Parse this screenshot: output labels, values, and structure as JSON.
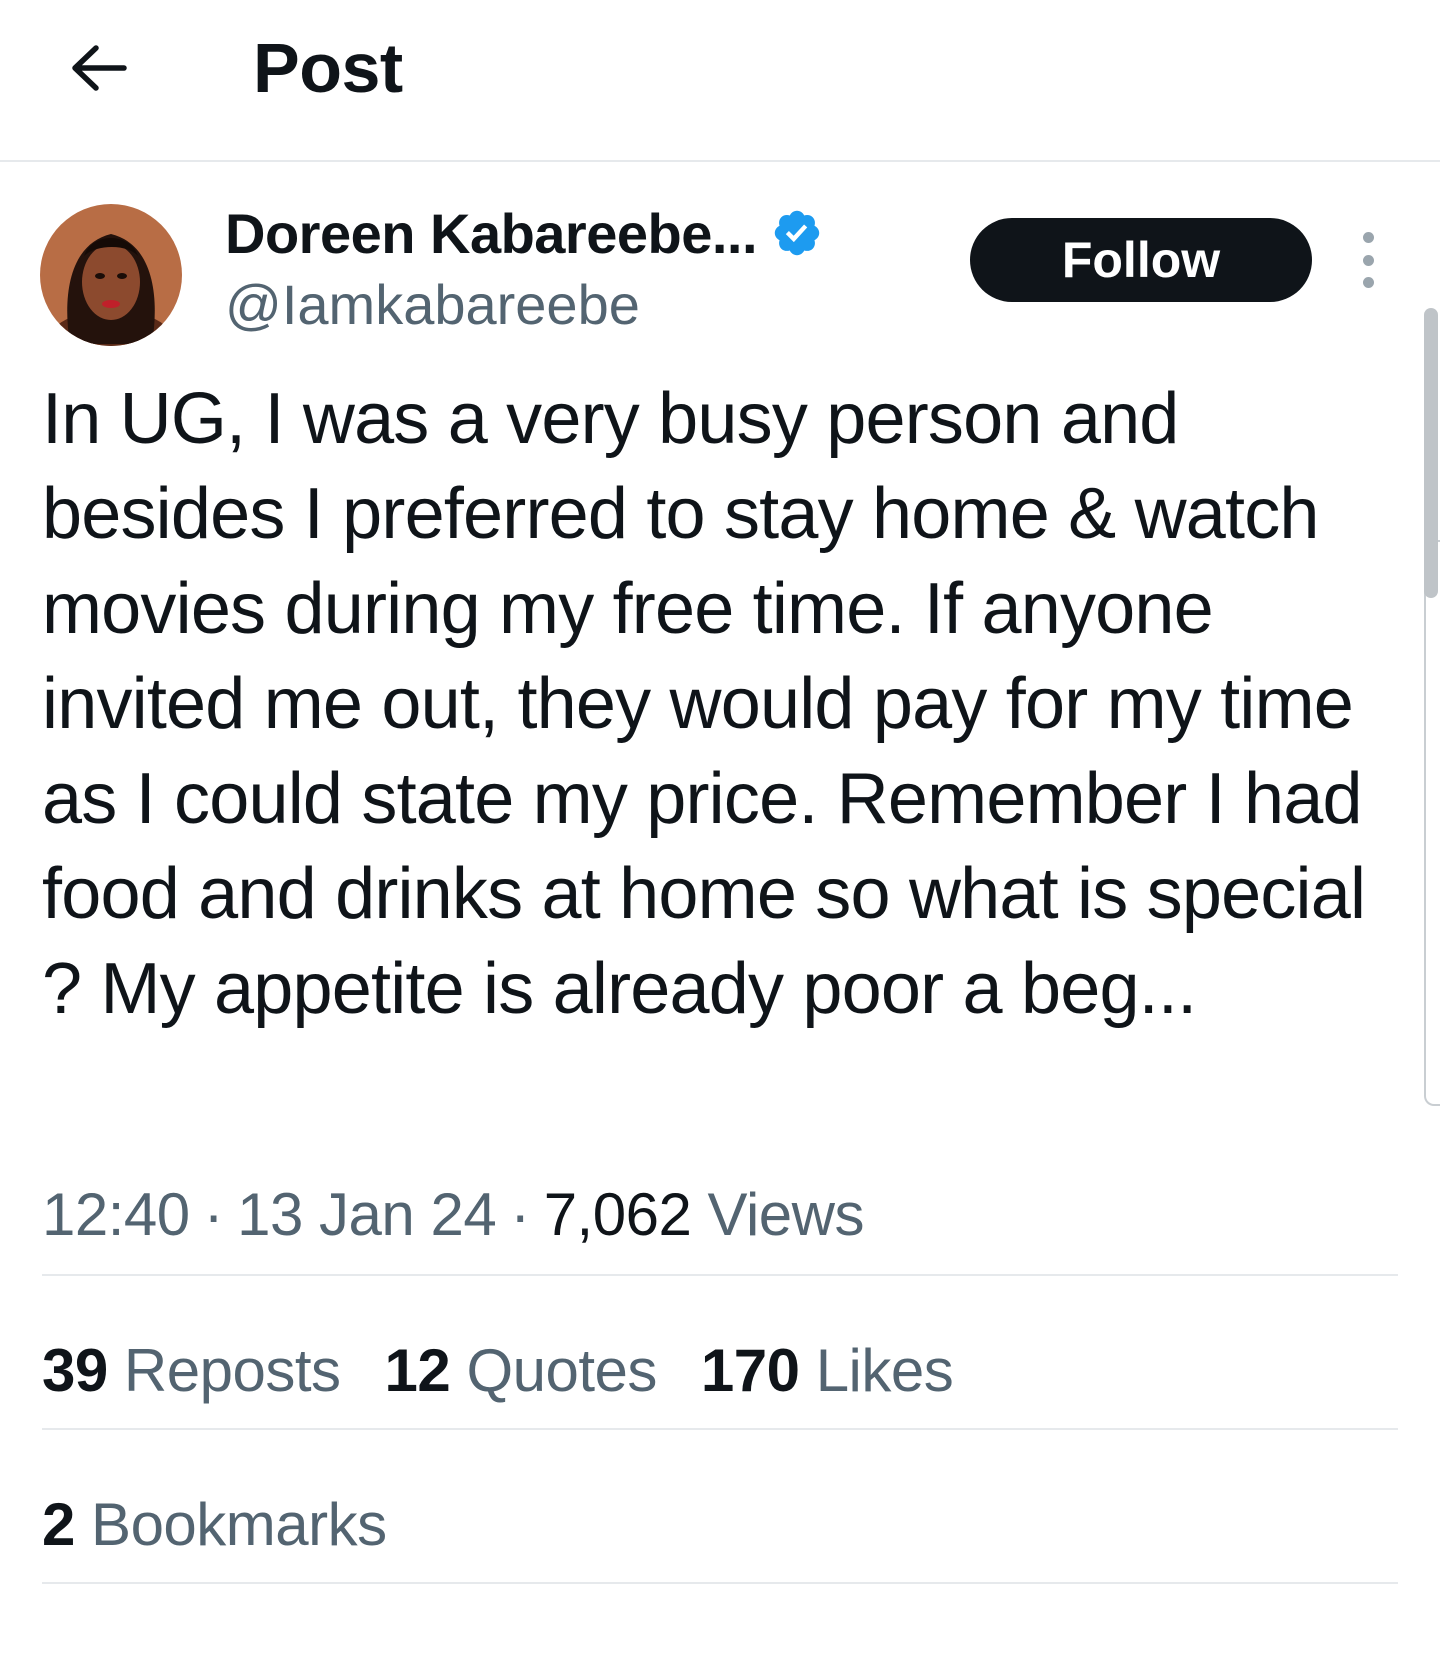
{
  "header": {
    "title": "Post",
    "back_icon": "arrow-left-icon"
  },
  "author": {
    "display_name": "Doreen Kabareebe...",
    "handle": "@Iamkabareebe",
    "verified_icon": "verified-badge-icon",
    "verified_color": "#1d9bf0",
    "follow_label": "Follow"
  },
  "post": {
    "text": "In UG, I was a very busy person and besides I preferred to stay home & watch movies during my free time. If anyone invited me out, they would pay for my time as I could state my price. Remember I had food and drinks at home so what is special ? My appetite is already poor a beg...",
    "time": "12:40",
    "date": "13 Jan 24",
    "views_count": "7,062",
    "views_label": "Views",
    "separator": "·"
  },
  "stats": {
    "reposts_count": "39",
    "reposts_label": "Reposts",
    "quotes_count": "12",
    "quotes_label": "Quotes",
    "likes_count": "170",
    "likes_label": "Likes",
    "bookmarks_count": "2",
    "bookmarks_label": "Bookmarks"
  }
}
